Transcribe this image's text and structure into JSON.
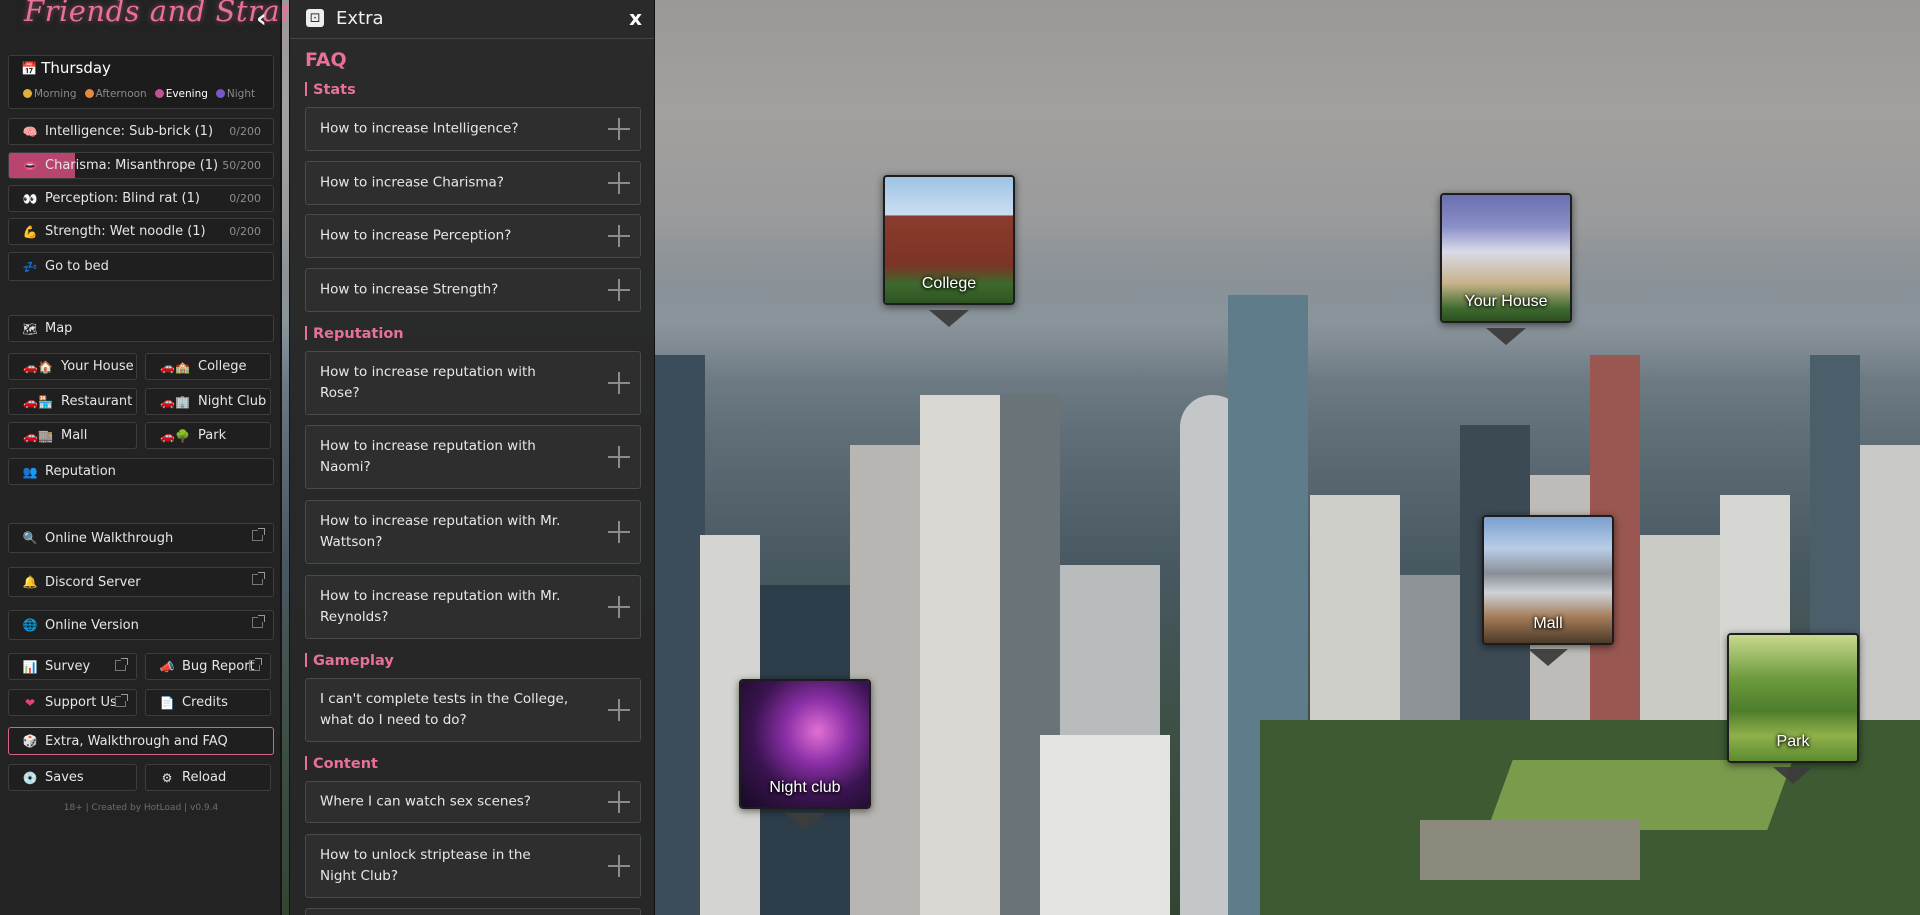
{
  "sidebar": {
    "game_title": "Friends and Strangers",
    "collapse_glyph": "‹",
    "day": {
      "name": "Thursday",
      "periods": [
        {
          "label": "Morning",
          "color": "#e2b13c",
          "active": false
        },
        {
          "label": "Afternoon",
          "color": "#e58a3a",
          "active": false
        },
        {
          "label": "Evening",
          "color": "#c74f9a",
          "active": true
        },
        {
          "label": "Night",
          "color": "#7a57c8",
          "active": false
        }
      ]
    },
    "stats": [
      {
        "label": "Intelligence: Sub-brick (1)",
        "value": "0/200",
        "progress": 0,
        "icon": "brain-icon",
        "glyph": "🧠"
      },
      {
        "label": "Charisma: Misanthrope (1)",
        "value": "50/200",
        "progress": 0.25,
        "icon": "lips-icon",
        "glyph": "👄"
      },
      {
        "label": "Perception: Blind rat (1)",
        "value": "0/200",
        "progress": 0,
        "icon": "eyes-icon",
        "glyph": "👀"
      },
      {
        "label": "Strength: Wet noodle (1)",
        "value": "0/200",
        "progress": 0,
        "icon": "flexed-arm-icon",
        "glyph": "💪"
      }
    ],
    "go_to_bed": "Go to bed",
    "map": "Map",
    "locations": [
      {
        "label": "Your House",
        "glyph": "🏠"
      },
      {
        "label": "College",
        "glyph": "🏫"
      },
      {
        "label": "Restaurant",
        "glyph": "🏪"
      },
      {
        "label": "Night Club",
        "glyph": "🏢"
      },
      {
        "label": "Mall",
        "glyph": "🏬"
      },
      {
        "label": "Park",
        "glyph": "🌳"
      }
    ],
    "reputation": "Reputation",
    "online_walkthrough": "Online Walkthrough",
    "discord_server": "Discord Server",
    "online_version": "Online Version",
    "survey": "Survey",
    "bug_report": "Bug Report",
    "support_us": "Support Us",
    "credits": "Credits",
    "extra_faq": "Extra, Walkthrough and FAQ",
    "saves": "Saves",
    "reload": "Reload",
    "footer": "18+ | Created by HotLoad | v0.9.4"
  },
  "extra": {
    "title": "Extra",
    "close": "x",
    "faq_heading": "FAQ",
    "sections": {
      "stats": "Stats",
      "reputation": "Reputation",
      "gameplay": "Gameplay",
      "content": "Content"
    },
    "questions": {
      "q1": "How to increase Intelligence?",
      "q2": "How to increase Charisma?",
      "q3": "How to increase Perception?",
      "q4": "How to increase Strength?",
      "q5": "How to increase reputation with Rose?",
      "q6": "How to increase reputation with Naomi?",
      "q7": "How to increase reputation with Mr. Wattson?",
      "q8": "How to increase reputation with Mr. Reynolds?",
      "q9": "I can't complete tests in the College, what do I need to do?",
      "q10": "Where I can watch sex scenes?",
      "q11": "How to unlock striptease in the Night Club?"
    }
  },
  "map_locations": {
    "college": "College",
    "your_house": "Your House",
    "mall": "Mall",
    "night_club": "Night club",
    "park": "Park"
  },
  "colors": {
    "accent_pink": "#e8709b",
    "charisma_fill": "#b84470",
    "panel_bg": "#262626"
  }
}
